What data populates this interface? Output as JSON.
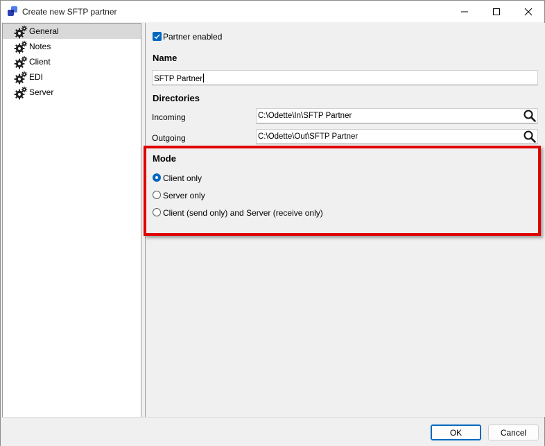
{
  "window": {
    "title": "Create new SFTP partner",
    "icons": {
      "app": "app-logo-icon",
      "minimize": "minimize-icon",
      "maximize": "maximize-icon",
      "close": "close-icon"
    }
  },
  "sidebar": {
    "items": [
      {
        "label": "General",
        "icon": "gears-icon",
        "selected": true
      },
      {
        "label": "Notes",
        "icon": "gears-icon",
        "selected": false
      },
      {
        "label": "Client",
        "icon": "gears-icon",
        "selected": false
      },
      {
        "label": "EDI",
        "icon": "gears-icon",
        "selected": false
      },
      {
        "label": "Server",
        "icon": "gears-icon",
        "selected": false
      }
    ]
  },
  "general": {
    "partner_enabled_label": "Partner enabled",
    "partner_enabled": true,
    "name_title": "Name",
    "name_value": "SFTP Partner",
    "directories_title": "Directories",
    "incoming_label": "Incoming",
    "incoming_value": "C:\\Odette\\In\\SFTP Partner",
    "outgoing_label": "Outgoing",
    "outgoing_value": "C:\\Odette\\Out\\SFTP Partner",
    "browse_icon": "search-icon",
    "mode_title": "Mode",
    "modes": [
      {
        "label": "Client only",
        "selected": true
      },
      {
        "label": "Server only",
        "selected": false
      },
      {
        "label": "Client (send only) and Server (receive only)",
        "selected": false
      }
    ]
  },
  "footer": {
    "ok_label": "OK",
    "cancel_label": "Cancel"
  },
  "colors": {
    "accent": "#0067c0",
    "highlight_frame": "#e00000",
    "selection": "#d9d9d9"
  }
}
